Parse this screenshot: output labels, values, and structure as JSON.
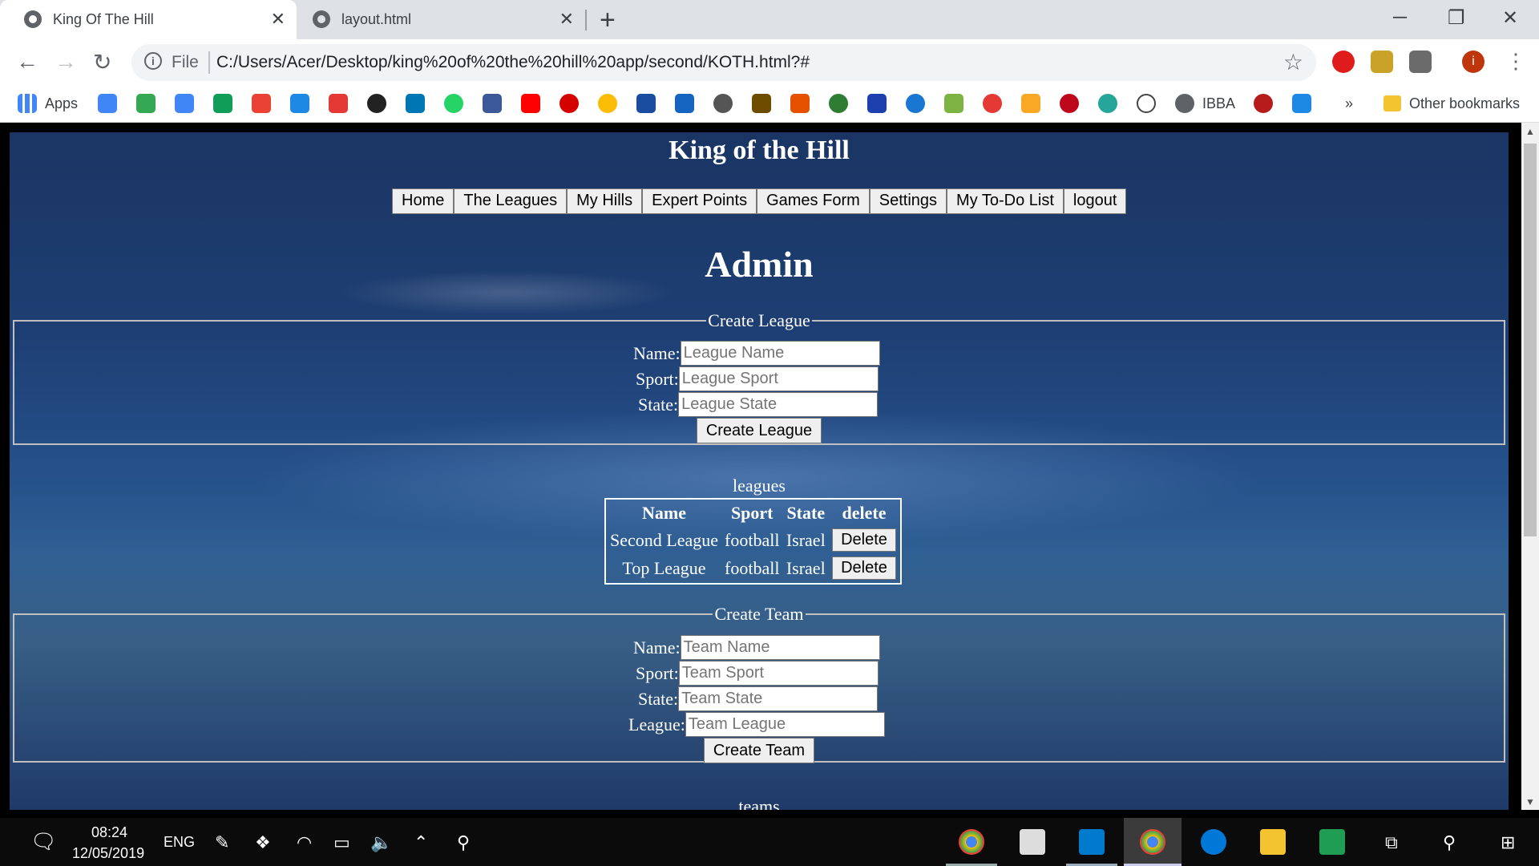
{
  "browser": {
    "tabs": [
      {
        "title": "King Of The Hill",
        "active": true
      },
      {
        "title": "layout.html",
        "active": false
      }
    ],
    "file_label": "File",
    "url": "C:/Users/Acer/Desktop/king%20of%20the%20hill%20app/second/KOTH.html?#",
    "bookmarks": {
      "apps_label": "Apps",
      "ibba_label": "IBBA",
      "more_label": "»",
      "other_label": "Other bookmarks"
    }
  },
  "page": {
    "site_title": "King of the Hill",
    "nav": [
      "Home",
      "The Leagues",
      "My Hills",
      "Expert Points",
      "Games Form",
      "Settings",
      "My To-Do List",
      "logout"
    ],
    "heading": "Admin",
    "create_league": {
      "legend": "Create League",
      "name_label": "Name:",
      "name_placeholder": "League Name",
      "sport_label": "Sport:",
      "sport_placeholder": "League Sport",
      "state_label": "State:",
      "state_placeholder": "League State",
      "submit": "Create League"
    },
    "leagues": {
      "caption": "leagues",
      "headers": [
        "Name",
        "Sport",
        "State",
        "delete"
      ],
      "rows": [
        {
          "name": "Second League",
          "sport": "football",
          "state": "Israel",
          "action": "Delete"
        },
        {
          "name": "Top League",
          "sport": "football",
          "state": "Israel",
          "action": "Delete"
        }
      ]
    },
    "create_team": {
      "legend": "Create Team",
      "name_label": "Name:",
      "name_placeholder": "Team Name",
      "sport_label": "Sport:",
      "sport_placeholder": "Team Sport",
      "state_label": "State:",
      "state_placeholder": "Team State",
      "league_label": "League:",
      "league_placeholder": "Team League",
      "submit": "Create Team"
    },
    "teams_caption": "teams"
  },
  "taskbar": {
    "time": "08:24",
    "date": "12/05/2019",
    "language": "ENG"
  }
}
